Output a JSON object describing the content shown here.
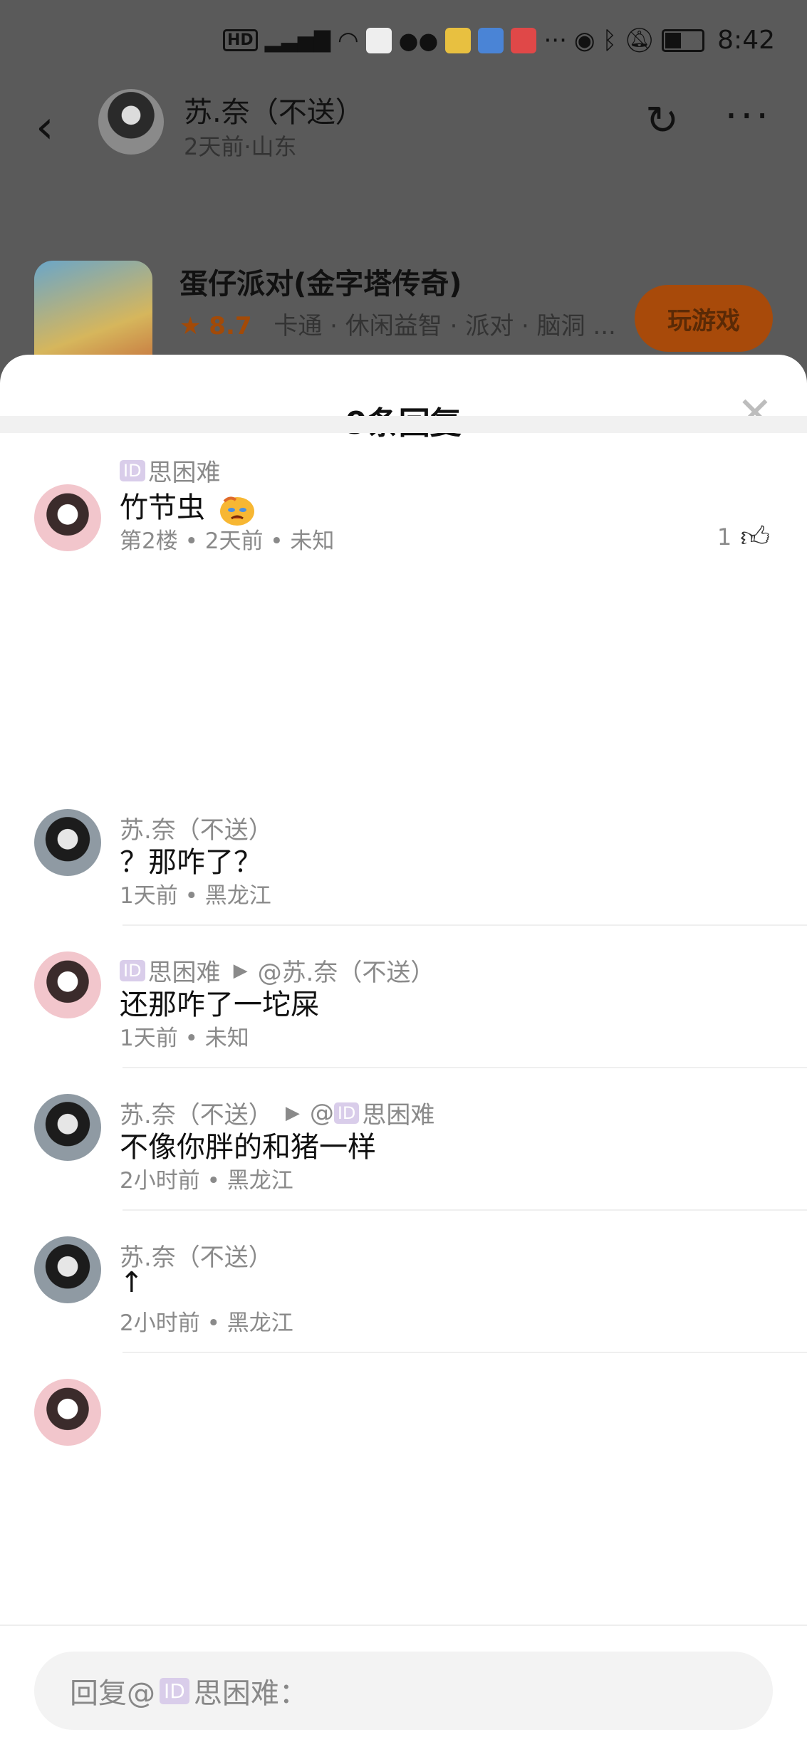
{
  "status_bar": {
    "icons": [
      "hd-icon",
      "signal-4g-icon",
      "wifi-icon",
      "shopping-icon",
      "wechat-icon",
      "weibo-icon",
      "browser-icon",
      "app-icon",
      "more-dots-icon",
      "eye-icon",
      "bluetooth-icon",
      "mute-bell-icon",
      "battery-icon"
    ],
    "time": "8:42"
  },
  "post_header": {
    "author": "苏.奈（不送）",
    "meta": "2天前·山东"
  },
  "game": {
    "title": "蛋仔派对(金字塔传奇)",
    "rating": "8.7",
    "tags": "卡通 · 休闲益智 · 派对 · 脑洞 ...",
    "play_label": "玩游戏"
  },
  "sheet": {
    "title": "9条回复"
  },
  "main_comment": {
    "badge": "ID",
    "user": "思困难",
    "text": "竹节虫",
    "meta": "第2楼 • 2天前 • 未知",
    "likes": "1"
  },
  "replies": [
    {
      "user": "苏.奈（不送）",
      "text": "？那咋了？",
      "meta": "1天前 • 黑龙江"
    },
    {
      "badge": "ID",
      "user": "思困难",
      "target": "@苏.奈（不送）",
      "text": "还那咋了一坨屎",
      "meta": "1天前 • 未知"
    },
    {
      "user": "苏.奈（不送）",
      "target_prefix": "@",
      "target_badge": "ID",
      "target": "思困难",
      "text": "不像你胖的和猪一样",
      "meta": "2小时前 • 黑龙江"
    },
    {
      "user": "苏.奈（不送）",
      "text": "↑",
      "meta": "2小时前 • 黑龙江"
    }
  ],
  "reply_bar": {
    "prefix": "回复@",
    "badge": "ID",
    "target": "思困难："
  }
}
